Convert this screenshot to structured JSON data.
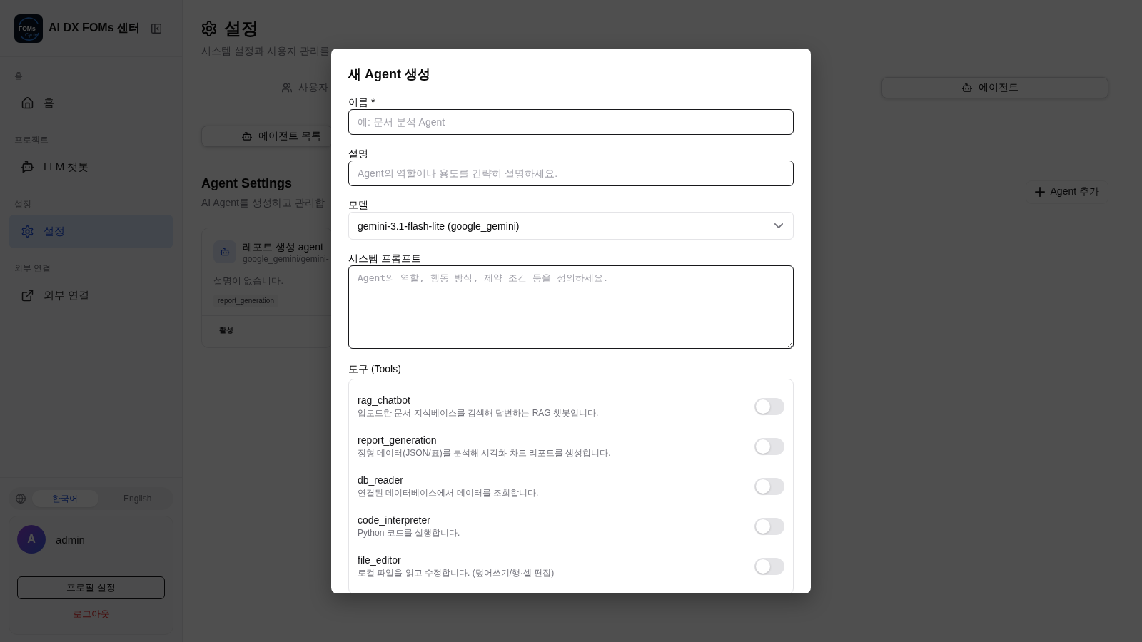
{
  "sidebar": {
    "brand": {
      "logo_words": [
        "FOMs",
        "Cycle"
      ],
      "title": "AI DX FOMs 센터"
    },
    "sections": [
      {
        "label": "홈",
        "items": [
          {
            "kind": "home",
            "label": "홈",
            "selected": false
          }
        ]
      },
      {
        "label": "프로젝트",
        "items": [
          {
            "kind": "chatbot",
            "label": "LLM 챗봇",
            "selected": false
          }
        ]
      },
      {
        "label": "설정",
        "items": [
          {
            "kind": "settings",
            "label": "설정",
            "selected": true
          }
        ]
      },
      {
        "label": "외부 연결",
        "items": [
          {
            "kind": "link",
            "label": "외부 연결",
            "selected": false
          }
        ]
      }
    ],
    "languages": [
      {
        "label": "한국어",
        "selected": true
      },
      {
        "label": "English",
        "selected": false
      }
    ],
    "user": {
      "initial": "A",
      "name": "admin",
      "profile_button": "프로필 설정",
      "logout": "로그아웃"
    }
  },
  "page": {
    "title": "설정",
    "subtitle": "시스템 설정과 사용자 관리를",
    "tabs": [
      {
        "kind": "users",
        "label": "사용자",
        "selected": false
      },
      {
        "kind": "agents",
        "label": "에이전트",
        "selected": true
      }
    ],
    "sub_tabs": [
      {
        "kind": "agents",
        "label": "에이전트 목록",
        "selected": true
      }
    ],
    "section": {
      "title": "Agent Settings",
      "subtitle": "AI Agent를 생성하고 관리합",
      "add_button": "Agent 추가"
    },
    "agents": [
      {
        "name": "레포트 생성 agent",
        "model": "google_gemini/gemini-",
        "description": "설명이 없습니다.",
        "tools": [
          "report_generation"
        ],
        "status": "활성"
      }
    ]
  },
  "dialog": {
    "title": "새 Agent 생성",
    "fields": [
      {
        "kind": "text",
        "label": "이름 *",
        "placeholder": "예: 문서 분석 Agent"
      },
      {
        "kind": "text",
        "label": "설명",
        "placeholder": "Agent의 역할이나 용도를 간략히 설명하세요."
      },
      {
        "kind": "select",
        "label": "모델",
        "value": "gemini-3.1-flash-lite (google_gemini)"
      },
      {
        "kind": "textarea",
        "label": "시스템 프롬프트",
        "placeholder": "Agent의 역할, 행동 방식, 제약 조건 등을 정의하세요."
      }
    ],
    "tools_label": "도구 (Tools)",
    "tools": [
      {
        "name": "rag_chatbot",
        "description": "업로드한 문서 지식베이스를 검색해 답변하는 RAG 챗봇입니다.",
        "on": false
      },
      {
        "name": "report_generation",
        "description": "정형 데이터(JSON/표)를 분석해 시각화 차트 리포트를 생성합니다.",
        "on": false
      },
      {
        "name": "db_reader",
        "description": "연결된 데이터베이스에서 데이터를 조회합니다.",
        "on": false
      },
      {
        "name": "code_interpreter",
        "description": "Python 코드를 실행합니다.",
        "on": false
      },
      {
        "name": "file_editor",
        "description": "로컬 파일을 읽고 수정합니다. (덮어쓰기/행·셀 편집)",
        "on": false
      }
    ]
  }
}
